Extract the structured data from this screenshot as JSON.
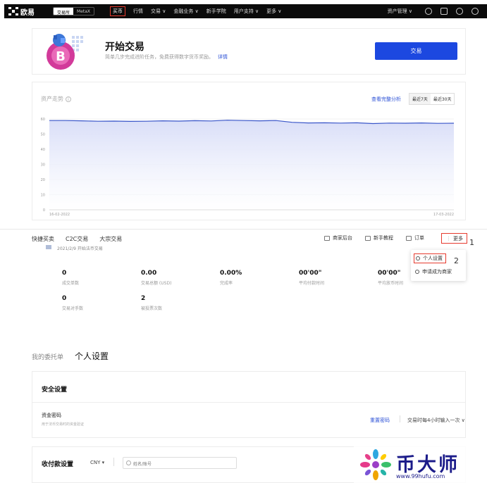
{
  "topbar": {
    "logo": "欧易",
    "seg": [
      "交易所",
      "MetaX"
    ],
    "nav": [
      "买币",
      "行情",
      "交易 ∨",
      "金融业务 ∨",
      "新手学院",
      "用户支持 ∨",
      "更多 ∨"
    ],
    "asset_menu": "资产管理 ∨"
  },
  "hero": {
    "title": "开始交易",
    "subtitle": "简单几步完成进阶任务，免费获得数字货币奖励。",
    "link": "详情",
    "button": "交易"
  },
  "assets": {
    "title": "资产走势",
    "info": "i",
    "link": "查看完整分析",
    "range": [
      "最近7天",
      "最近30天"
    ]
  },
  "chart_data": {
    "type": "area",
    "x": [
      "16-02-2022",
      "17-03-2022"
    ],
    "xticks": [
      "16-02-2022",
      "17-03-2022"
    ],
    "yticks": [
      "0",
      "10",
      "20",
      "30",
      "40",
      "50",
      "60"
    ],
    "ylim": [
      0,
      60
    ],
    "values": [
      59,
      59,
      58.8,
      58.5,
      58.6,
      58.4,
      58.5,
      58.8,
      58.6,
      58.9,
      58.7,
      59.2,
      59.0,
      58.8,
      59.0,
      57.8,
      57.4,
      57.5,
      57.3,
      57.5,
      57.0,
      57.3,
      57.2,
      57.4,
      57.1,
      57.2
    ],
    "line_color": "#3a56c9",
    "fill_color": "#d9def8"
  },
  "subnav": {
    "left": [
      "快捷买卖",
      "C2C交易",
      "大宗交易"
    ],
    "right": [
      "商家后台",
      "新手教程",
      "订单"
    ],
    "more": "更多",
    "annot1": "1"
  },
  "stats": {
    "head": "2021/2/9 开始法币交易",
    "items": [
      {
        "value": "0",
        "label": "成交单数"
      },
      {
        "value": "0.00",
        "label": "交易总额 (USD)"
      },
      {
        "value": "0.00%",
        "label": "完成率"
      },
      {
        "value": "00'00\"",
        "label": "平均付款时间"
      },
      {
        "value": "00'00\"",
        "label": "平均放币时间"
      },
      {
        "value": "0",
        "label": "交易对手数"
      },
      {
        "value": "2",
        "label": "被投票次数"
      }
    ]
  },
  "dropdown": {
    "items": [
      "个人设置",
      "申请成为商家"
    ],
    "annot2": "2"
  },
  "tabs": [
    "我的委托单",
    "个人设置"
  ],
  "security": {
    "title": "安全设置",
    "password_label": "资金密码",
    "password_desc": "用于法币交易时的资金验证",
    "reset": "重置密码",
    "when": "交易时每4小时输入一次 ∨"
  },
  "payment": {
    "title": "收付款设置",
    "currency": "CNY ▾",
    "search_placeholder": "姓名/账号"
  },
  "watermark": {
    "text": "币大师",
    "url": "www.99hufu.com"
  }
}
